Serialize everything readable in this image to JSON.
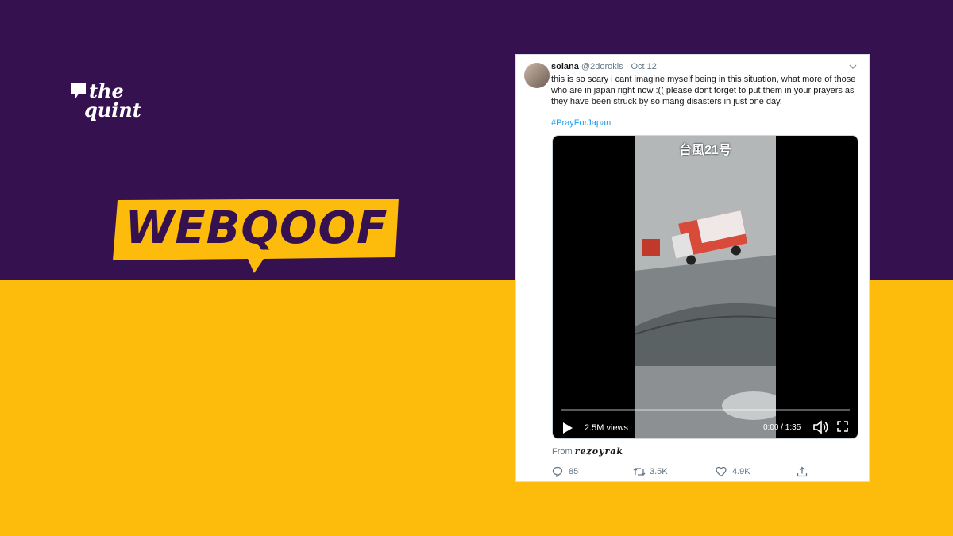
{
  "branding": {
    "logo_line1": "the",
    "logo_line2": "quint",
    "badge": "WEBQOOF",
    "colors": {
      "purple": "#351150",
      "yellow": "#fdbb0c"
    }
  },
  "tweet": {
    "name": "solana",
    "handle": "@2dorokis",
    "separator": "·",
    "date": "Oct 12",
    "text": "this is so scary i cant imagine myself being in this situation, what more of those who are in japan right now :(( please dont forget to put them in your prayers as they have been struck by so mang disasters in just one day.",
    "hashtag": "#PrayForJapan",
    "video": {
      "overlay_title": "台風21号",
      "views": "2.5M views",
      "time": "0:00 / 1:35"
    },
    "from_label": "From",
    "from_source": "rezoyrak",
    "stats": {
      "replies": "85",
      "retweets": "3.5K",
      "likes": "4.9K"
    },
    "icons": [
      "caret-down-icon",
      "play-icon",
      "volume-icon",
      "fullscreen-icon",
      "reply-icon",
      "retweet-icon",
      "like-icon",
      "share-icon"
    ]
  }
}
